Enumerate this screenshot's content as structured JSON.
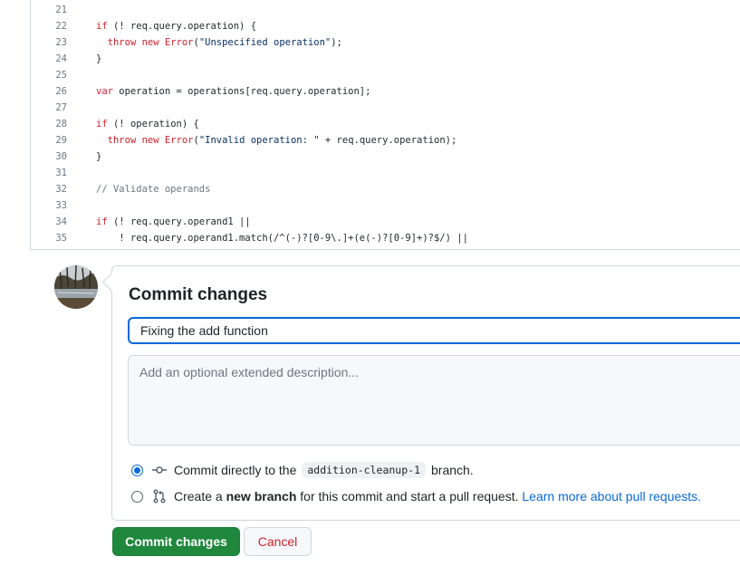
{
  "code": {
    "lines": [
      {
        "num": "21",
        "text": ""
      },
      {
        "num": "22",
        "text": "if (! req.query.operation) {"
      },
      {
        "num": "23",
        "text": "  throw new Error(\"Unspecified operation\");"
      },
      {
        "num": "24",
        "text": "}"
      },
      {
        "num": "25",
        "text": ""
      },
      {
        "num": "26",
        "text": "var operation = operations[req.query.operation];"
      },
      {
        "num": "27",
        "text": ""
      },
      {
        "num": "28",
        "text": "if (! operation) {"
      },
      {
        "num": "29",
        "text": "  throw new Error(\"Invalid operation: \" + req.query.operation);"
      },
      {
        "num": "30",
        "text": "}"
      },
      {
        "num": "31",
        "text": ""
      },
      {
        "num": "32",
        "text": "// Validate operands"
      },
      {
        "num": "33",
        "text": ""
      },
      {
        "num": "34",
        "text": "if (! req.query.operand1 ||"
      },
      {
        "num": "35",
        "text": "    ! req.query.operand1.match(/^(-)?[0-9\\.]+(e(-)?[0-9]+)?$/) ||"
      }
    ]
  },
  "commit": {
    "title": "Commit changes",
    "summary_value": "Fixing the add function",
    "description_placeholder": "Add an optional extended description...",
    "option_direct": {
      "prefix": "Commit directly to the",
      "branch": "addition-cleanup-1",
      "suffix": "branch.",
      "selected": true
    },
    "option_new_branch": {
      "prefix": "Create a",
      "bold": "new branch",
      "middle": "for this commit and start a pull request.",
      "link": "Learn more about pull requests.",
      "selected": false
    },
    "submit_label": "Commit changes",
    "cancel_label": "Cancel"
  },
  "colors": {
    "accent": "#0969da",
    "primary_button": "#1f883d",
    "cancel_text": "#cf222e",
    "keyword": "#cf222e"
  },
  "icons": {
    "direct_commit": "git-commit-icon",
    "new_branch": "git-pull-request-icon",
    "avatar": "user-avatar"
  }
}
